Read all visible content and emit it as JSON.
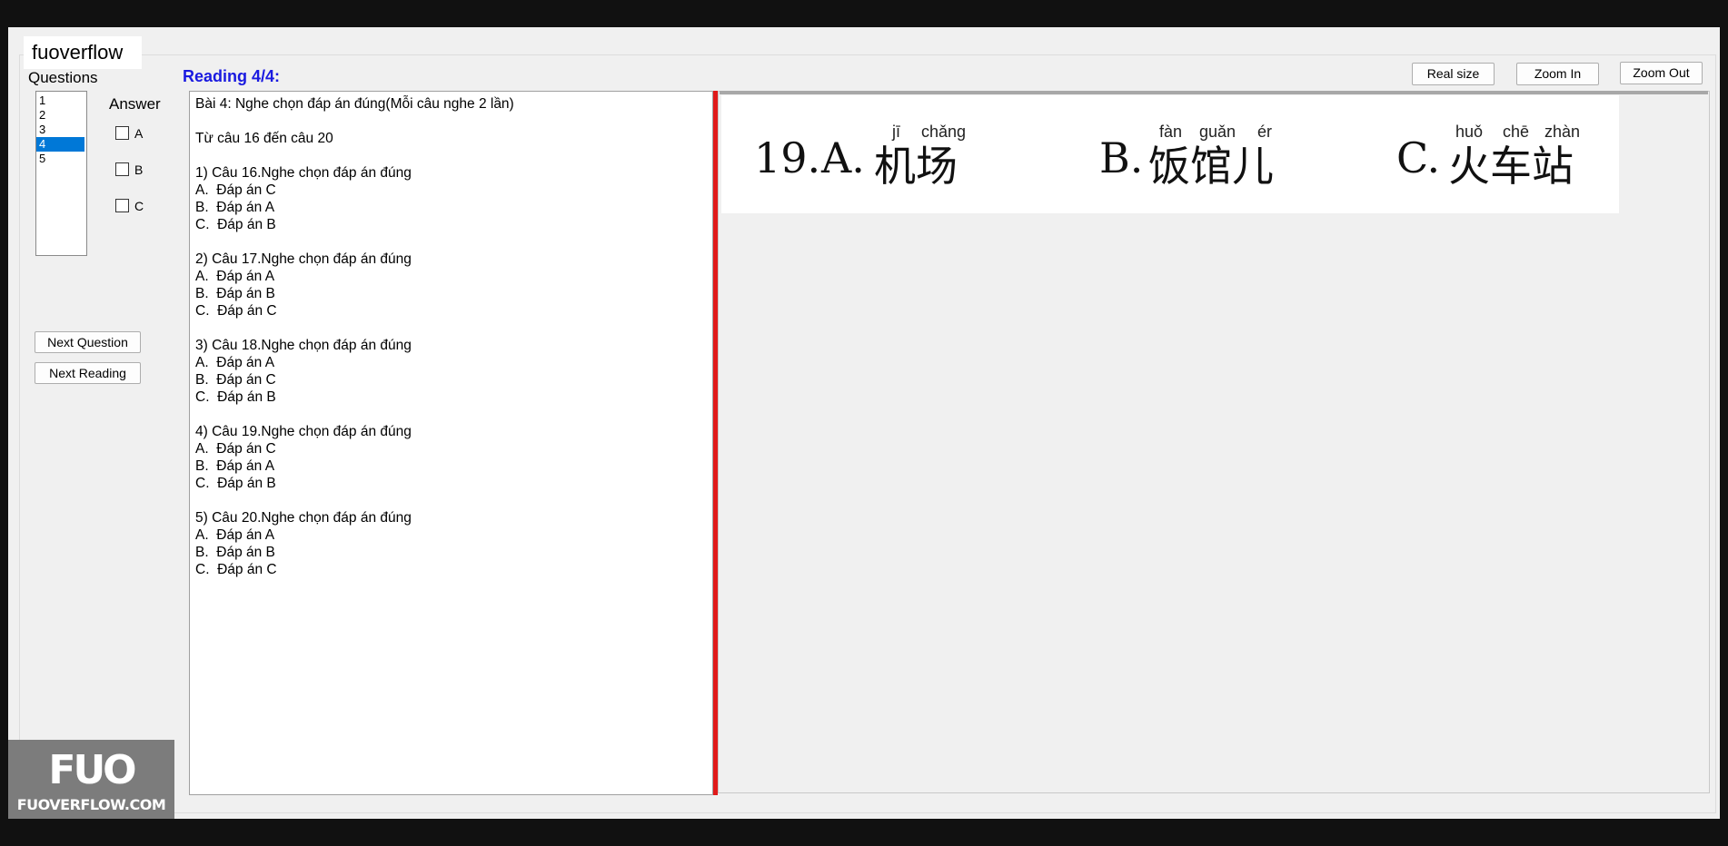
{
  "app": {
    "tab_title": "fuoverflow"
  },
  "questions": {
    "label": "Questions",
    "items": [
      "1",
      "2",
      "3",
      "4",
      "5"
    ],
    "selected": "4"
  },
  "answer": {
    "label": "Answer",
    "options": [
      "A",
      "B",
      "C"
    ]
  },
  "buttons": {
    "next_question": "Next Question",
    "next_reading": "Next Reading",
    "real_size": "Real size",
    "zoom_in": "Zoom In",
    "zoom_out": "Zoom Out"
  },
  "reading": {
    "title": "Reading 4/4",
    "colon": ":",
    "lines": [
      "Bài 4: Nghe chọn đáp án đúng(Mỗi câu nghe 2 lần)",
      "",
      "Từ câu 16 đến câu 20",
      "",
      "1) Câu 16.Nghe chọn đáp án đúng",
      "A.  Đáp án C",
      "B.  Đáp án A",
      "C.  Đáp án B",
      "",
      "2) Câu 17.Nghe chọn đáp án đúng",
      "A.  Đáp án A",
      "B.  Đáp án B",
      "C.  Đáp án C",
      "",
      "3) Câu 18.Nghe chọn đáp án đúng",
      "A.  Đáp án A",
      "B.  Đáp án C",
      "C.  Đáp án B",
      "",
      "4) Câu 19.Nghe chọn đáp án đúng",
      "A.  Đáp án C",
      "B.  Đáp án A",
      "C.  Đáp án B",
      "",
      "5) Câu 20.Nghe chọn đáp án đúng",
      "A.  Đáp án A",
      "B.  Đáp án B",
      "C.  Đáp án C"
    ]
  },
  "image": {
    "number": "19.",
    "option_a": {
      "letter": "A.",
      "hanzi": "机场",
      "pinyin": [
        "jī",
        "chǎng"
      ]
    },
    "option_b": {
      "letter": "B.",
      "hanzi": "饭馆儿",
      "pinyin": [
        "fàn",
        "guǎn",
        "ér"
      ]
    },
    "option_c": {
      "letter": "C.",
      "hanzi": "火车站",
      "pinyin": [
        "huǒ",
        "chē",
        "zhàn"
      ]
    }
  },
  "watermark": {
    "logo": "FUO",
    "site": "FUOVERFLOW.COM"
  }
}
